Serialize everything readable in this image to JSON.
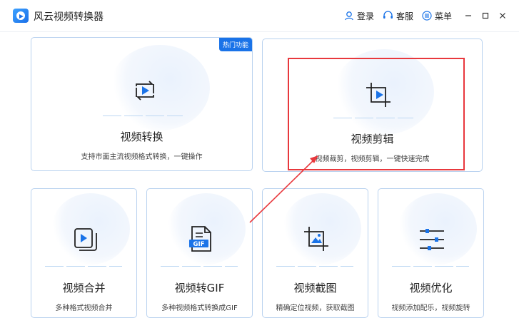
{
  "window": {
    "title": "风云视频转换器",
    "login": "登录",
    "support": "客服",
    "menu": "菜单"
  },
  "icons": {
    "logo": "app-logo-icon",
    "login": "user-icon",
    "support": "headset-icon",
    "menu": "menu-list-icon",
    "minimize": "minimize-icon",
    "maximize": "maximize-icon",
    "close": "close-icon"
  },
  "colors": {
    "accent": "#1a73e8",
    "card_border": "#b9d2ef",
    "annotation": "#e8383d"
  },
  "features": {
    "convert": {
      "title": "视频转换",
      "desc": "支持市面主流视频格式转换，一键操作",
      "badge": "热门功能",
      "icon": "convert-video-icon"
    },
    "edit": {
      "title": "视频剪辑",
      "desc": "视频裁剪，视频剪辑，一键快速完成",
      "icon": "crop-video-icon"
    },
    "merge": {
      "title": "视频合并",
      "desc": "多种格式视频合并",
      "icon": "merge-video-icon"
    },
    "gif": {
      "title": "视频转GIF",
      "desc": "多种视频格式转换成GIF",
      "icon": "gif-file-icon",
      "icon_text": "GIF"
    },
    "screenshot": {
      "title": "视频截图",
      "desc": "精确定位视频，获取截图",
      "icon": "crop-image-icon"
    },
    "optimize": {
      "title": "视频优化",
      "desc": "视频添加配乐，视频旋转",
      "icon": "sliders-icon"
    }
  }
}
